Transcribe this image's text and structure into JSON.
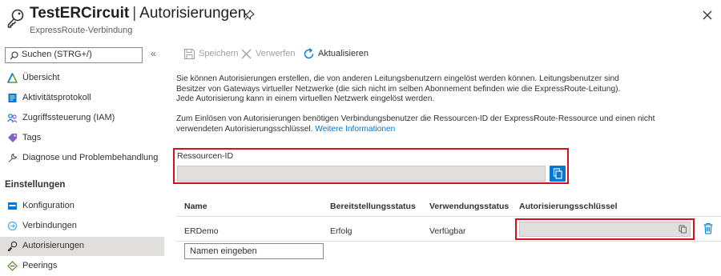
{
  "header": {
    "resource_name": "TestERCircuit",
    "separator": "|",
    "blade_title": "Autorisierungen",
    "subtitle": "ExpressRoute-Verbindung"
  },
  "sidebar": {
    "search_placeholder": "Suchen (STRG+/)",
    "collapse_glyph": "«",
    "items": [
      {
        "label": "Übersicht",
        "icon": "triangle-icon"
      },
      {
        "label": "Aktivitätsprotokoll",
        "icon": "log-icon"
      },
      {
        "label": "Zugriffssteuerung (IAM)",
        "icon": "people-icon"
      },
      {
        "label": "Tags",
        "icon": "tag-icon"
      },
      {
        "label": "Diagnose und Problembehandlung",
        "icon": "wrench-icon"
      }
    ],
    "section_title": "Einstellungen",
    "settings_items": [
      {
        "label": "Konfiguration",
        "icon": "config-icon"
      },
      {
        "label": "Verbindungen",
        "icon": "connections-icon"
      },
      {
        "label": "Autorisierungen",
        "icon": "key-icon",
        "active": true
      },
      {
        "label": "Peerings",
        "icon": "peering-icon"
      }
    ]
  },
  "toolbar": {
    "save_label": "Speichern",
    "discard_label": "Verwerfen",
    "refresh_label": "Aktualisieren"
  },
  "content": {
    "para1": [
      "Sie können Autorisierungen erstellen, die von anderen Leitungsbenutzern eingelöst werden können. Leitungsbenutzer sind",
      "Besitzer von Gateways virtueller Netzwerke (die sich nicht im selben Abonnement befinden wie die ExpressRoute-Leitung).",
      "Jede Autorisierung kann in einem virtuellen Netzwerk eingelöst werden."
    ],
    "para2": [
      "Zum Einlösen von Autorisierungen benötigen Verbindungsbenutzer die Ressourcen-ID der ExpressRoute-Ressource und einen nicht",
      "verwendeten Autorisierungsschlüssel."
    ],
    "more_info_link": "Weitere Informationen",
    "resource_id_label": "Ressourcen-ID",
    "resource_id_value": ""
  },
  "table": {
    "headers": [
      "Name",
      "Bereitstellungsstatus",
      "Verwendungsstatus",
      "Autorisierungsschlüssel"
    ],
    "rows": [
      {
        "name": "ERDemo",
        "provisioning": "Erfolg",
        "usage": "Verfügbar",
        "key": ""
      }
    ],
    "new_name_placeholder": "Namen eingeben"
  },
  "colors": {
    "accent": "#0078d4",
    "highlight_frame": "#d70f1e",
    "selected_nav": "#e1dfdd"
  }
}
